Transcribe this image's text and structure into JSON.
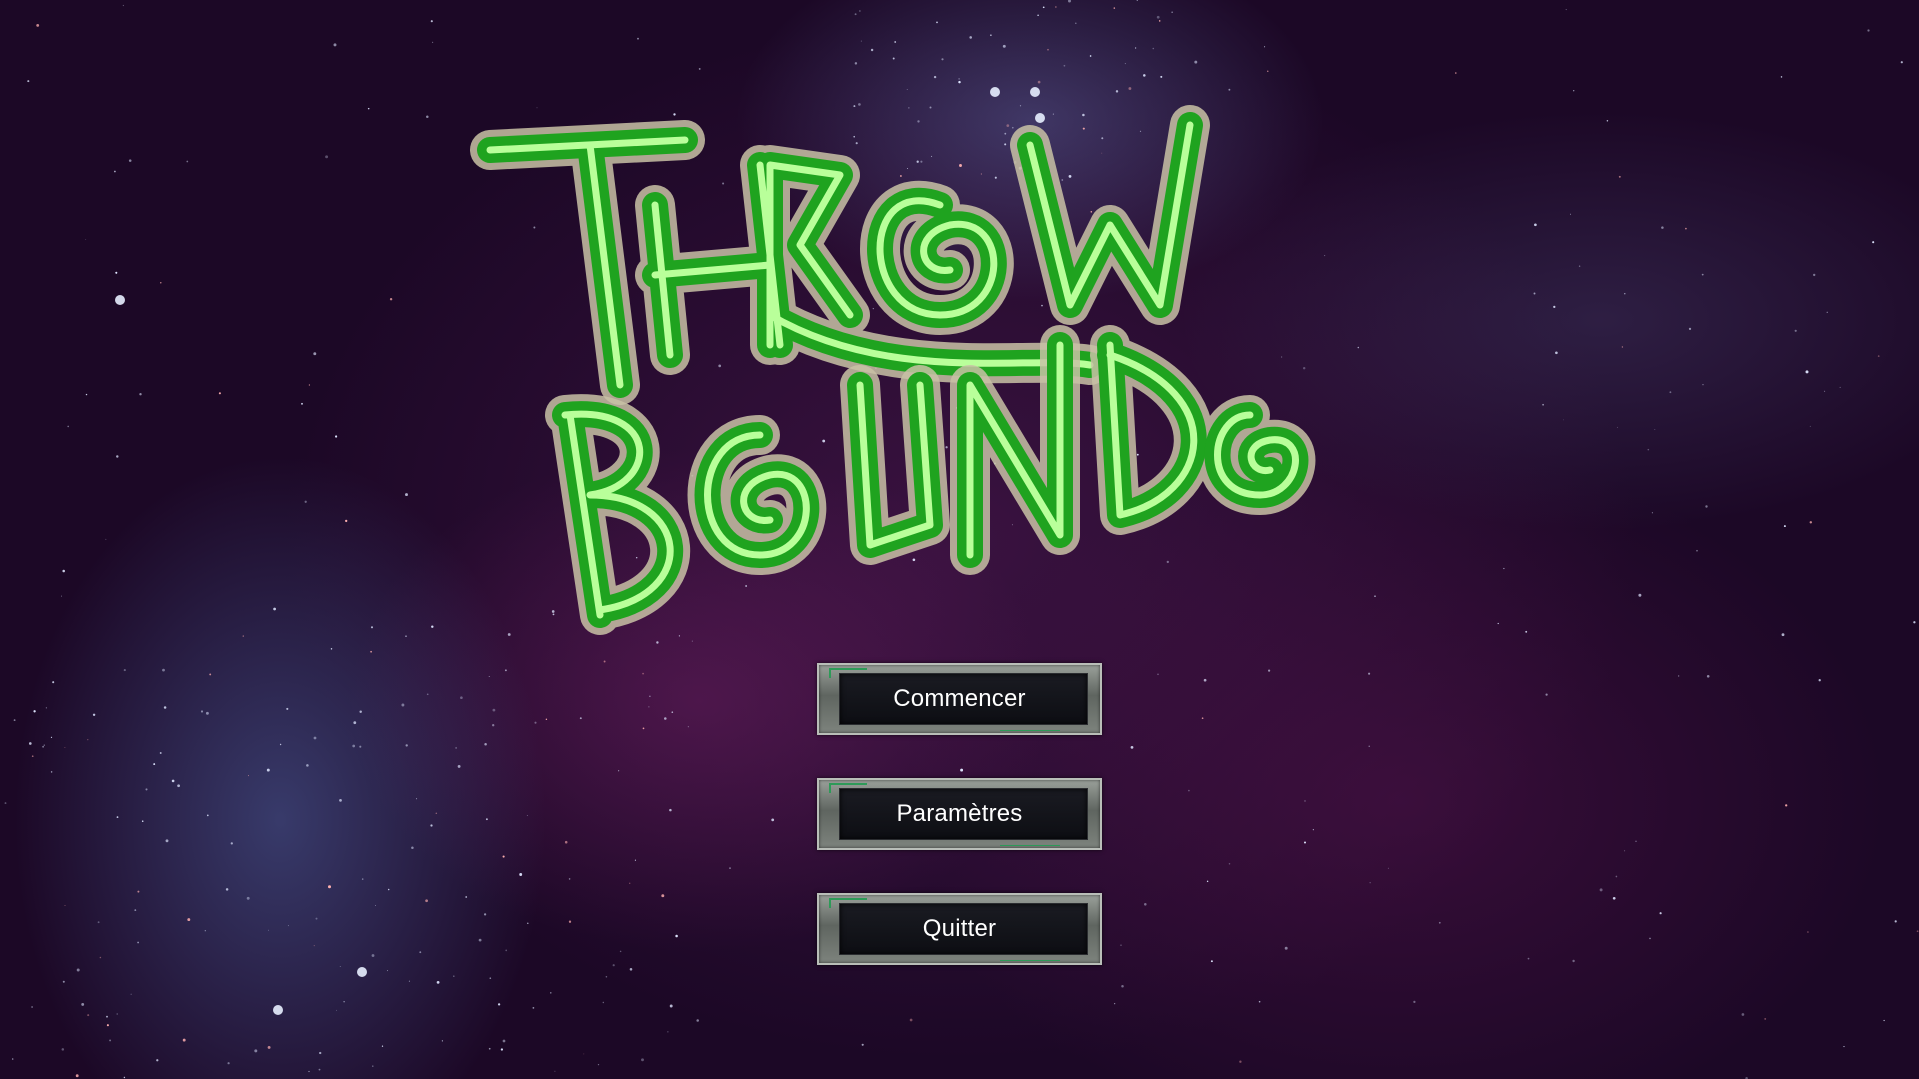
{
  "logo": {
    "text_line1": "THROW",
    "text_line2": "BOUND",
    "color": "#2ecc3a"
  },
  "menu": {
    "start_label": "Commencer",
    "settings_label": "Paramètres",
    "quit_label": "Quitter"
  },
  "colors": {
    "logo_green": "#2ecc3a",
    "logo_light_green": "#b9ff9a",
    "button_frame": "#7d837d",
    "button_face": "#111218",
    "accent_green": "#2e9a58"
  }
}
